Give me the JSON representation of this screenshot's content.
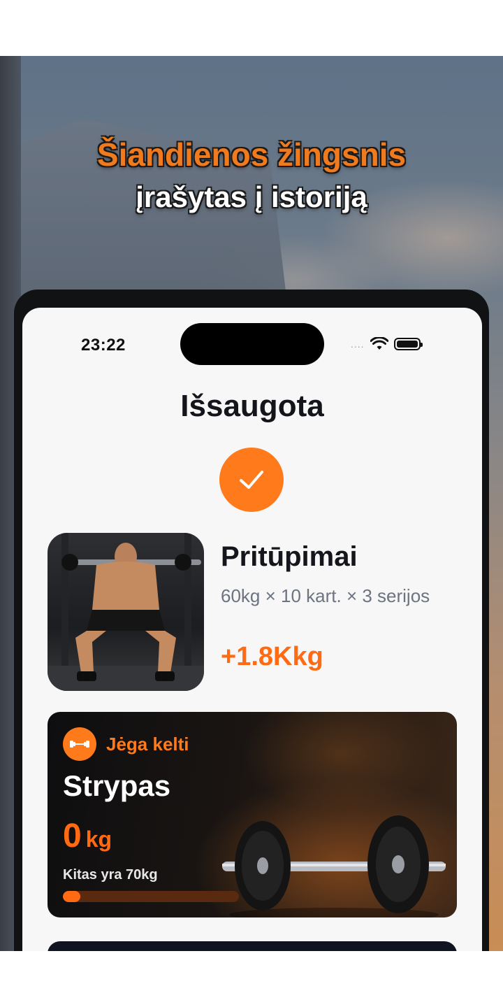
{
  "headline": {
    "line1": "Šiandienos žingsnis",
    "line2": "įrašytas į istoriją"
  },
  "statusbar": {
    "time": "23:22",
    "signal_dots": "....",
    "icons": [
      "wifi-icon",
      "battery-icon"
    ]
  },
  "screen": {
    "title": "Išsaugota",
    "status_icon": "checkmark-icon"
  },
  "exercise": {
    "name": "Pritūpimai",
    "description": "60kg × 10 kart. × 3 serijos",
    "gain": "+1.8Kkg",
    "image": "man-squatting-with-barbell"
  },
  "strength_card": {
    "badge_icon": "dumbbell-icon",
    "badge_label": "Jėga kelti",
    "title": "Strypas",
    "weight_value": "0",
    "weight_unit": "kg",
    "next_label": "Kitas yra 70kg",
    "progress_fraction": 0.1,
    "image": "barbell-icon"
  },
  "colors": {
    "accent": "#ff7a1a",
    "gain": "#ff6a13",
    "title_text": "#14151a",
    "muted_text": "#6d7480"
  }
}
